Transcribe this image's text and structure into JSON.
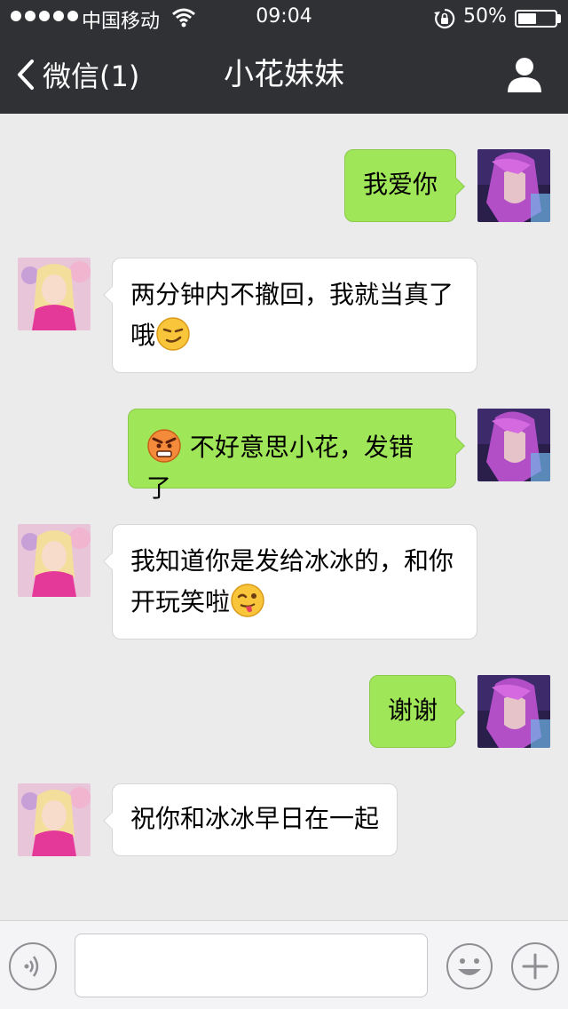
{
  "status_bar": {
    "carrier": "中国移动",
    "time": "09:04",
    "battery_percent": "50%",
    "battery_level": 0.5
  },
  "nav": {
    "back_label": "微信(1)",
    "title": "小花妹妹",
    "profile_icon": "person-icon"
  },
  "messages": [
    {
      "sender": "me",
      "text": "我爱你"
    },
    {
      "sender": "them",
      "line1": "两分钟内不撤回，我就当真了",
      "line2": "哦",
      "emoji": "smirk-emoji"
    },
    {
      "sender": "me",
      "text": "不好意思小花，发错了",
      "emoji": "angry-emoji"
    },
    {
      "sender": "them",
      "line1": "我知道你是发给冰冰的，和你",
      "line2": "开玩笑啦",
      "emoji": "wink-tongue-emoji"
    },
    {
      "sender": "me",
      "text": "谢谢"
    },
    {
      "sender": "them",
      "text": "祝你和冰冰早日在一起"
    }
  ],
  "input_bar": {
    "placeholder": "",
    "voice_icon": "voice-icon",
    "emoji_icon": "emoji-icon",
    "add_icon": "plus-icon"
  },
  "colors": {
    "nav_bg": "#2f3135",
    "bubble_me": "#9fe658",
    "bubble_them": "#ffffff",
    "chat_bg": "#ebebeb"
  }
}
